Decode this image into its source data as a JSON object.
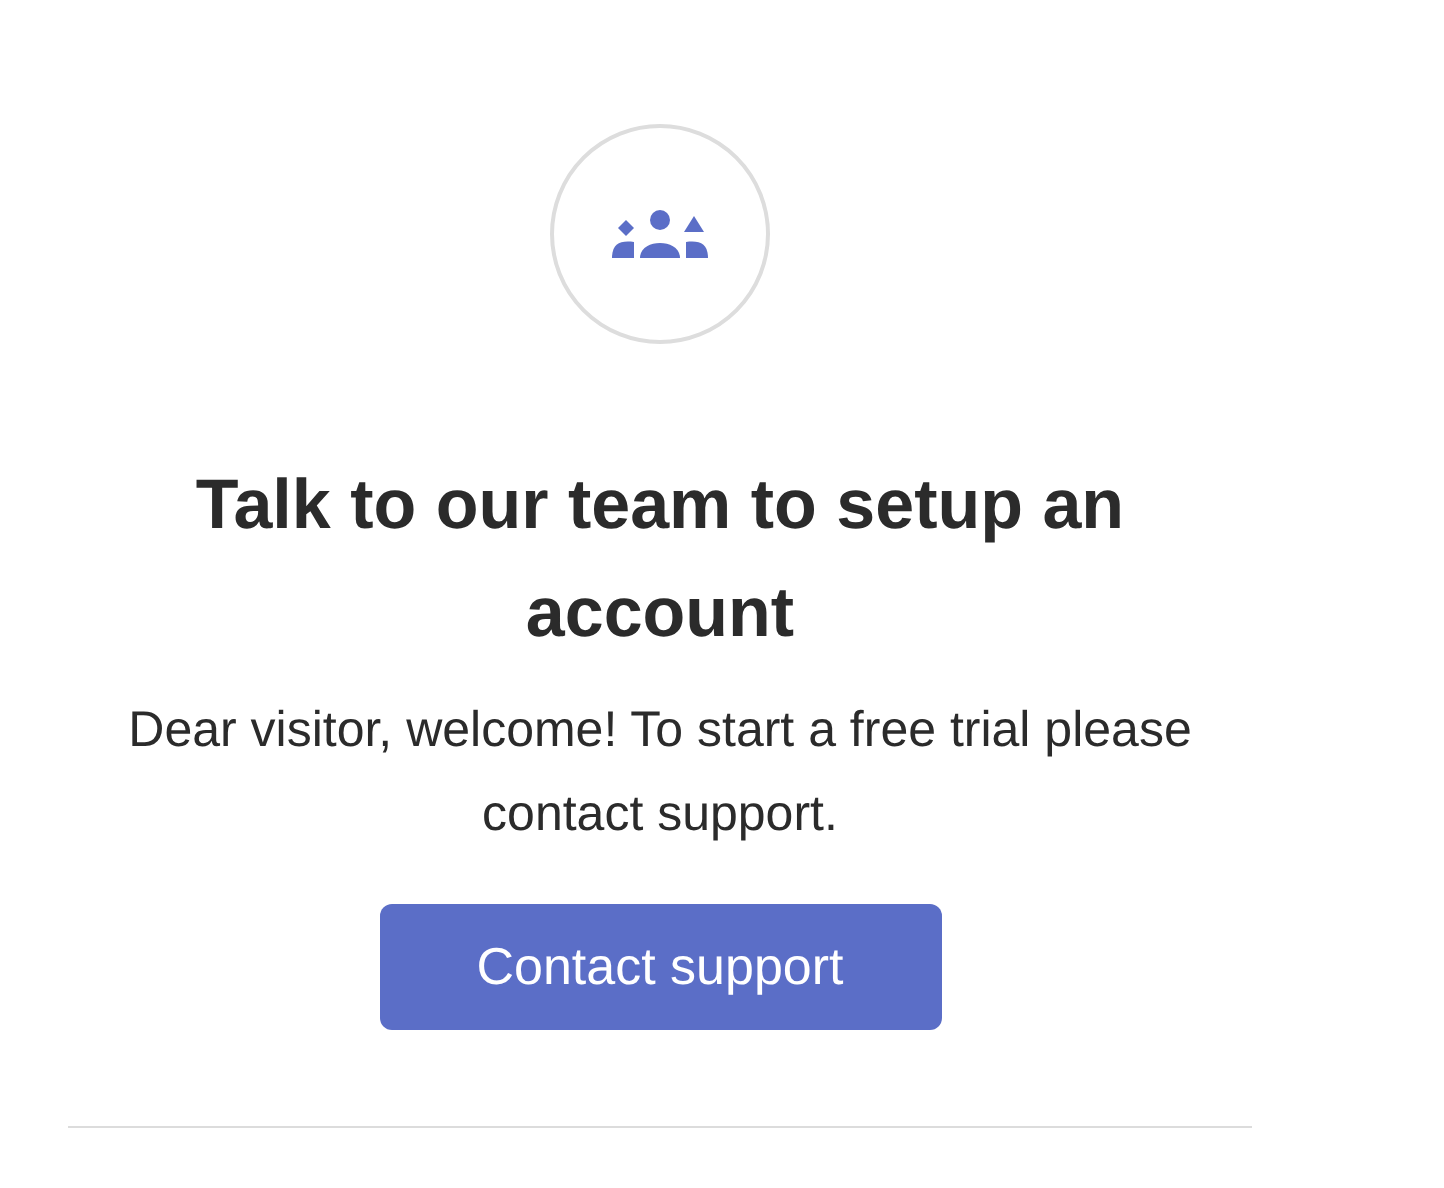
{
  "heading": "Talk to our team to setup an account",
  "message": "Dear visitor, welcome! To start a free trial please contact support.",
  "button": {
    "label": "Contact support"
  }
}
